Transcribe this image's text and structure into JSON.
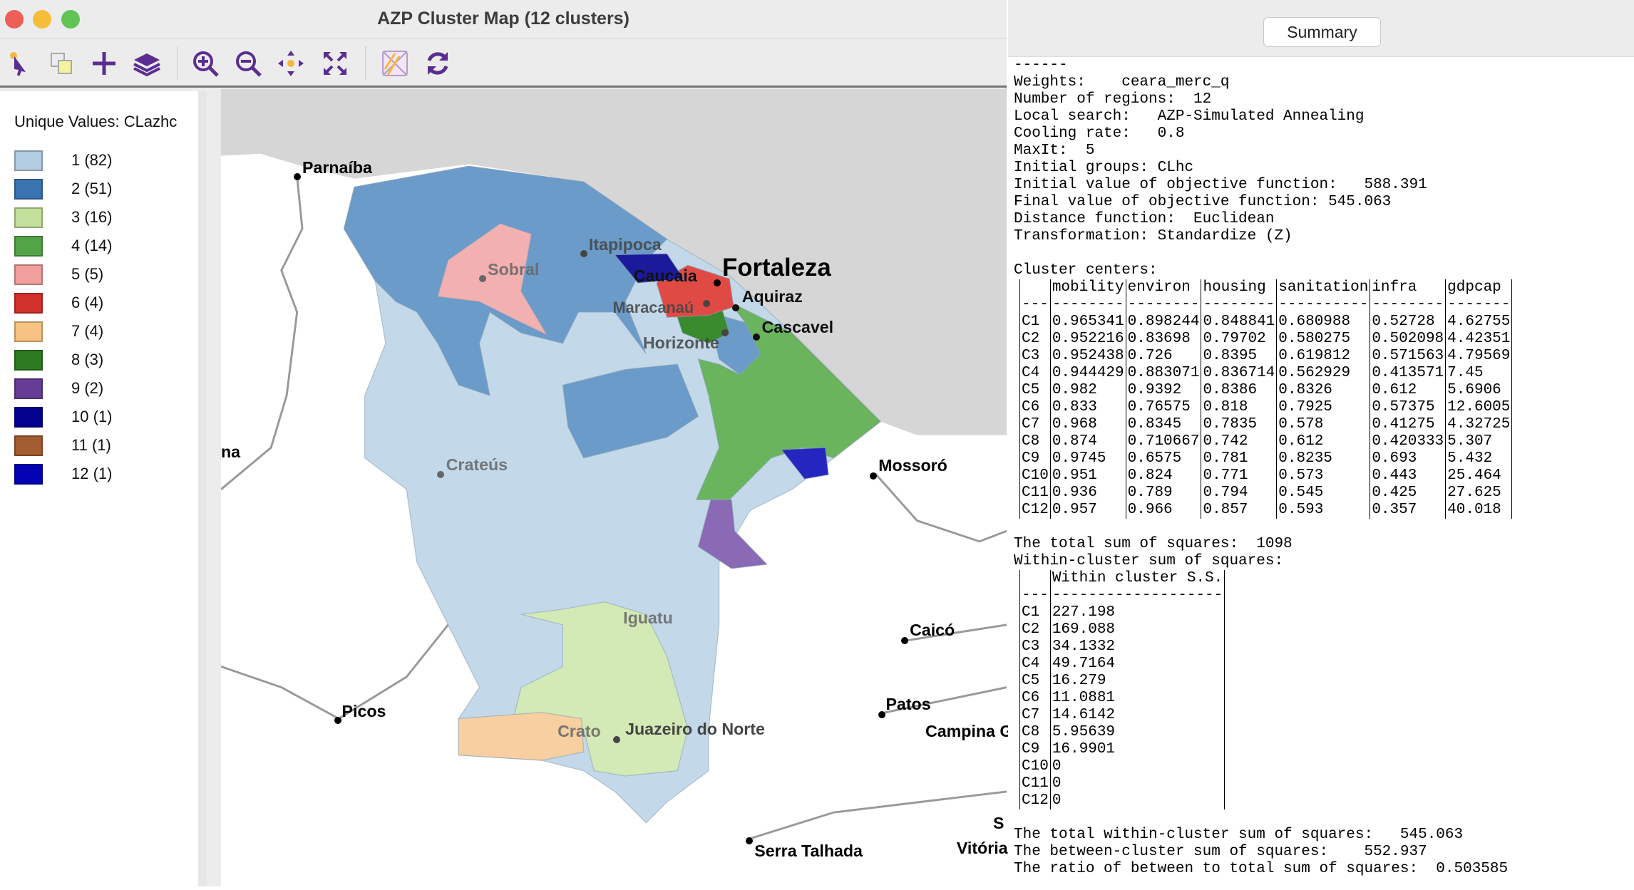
{
  "window": {
    "title": "AZP Cluster Map (12 clusters)",
    "traffic_lights": [
      "#ee5f57",
      "#f6bd3b",
      "#5fc454"
    ]
  },
  "toolbar": {
    "icons": [
      "select-pointer-icon",
      "copy-selection-icon",
      "add-icon",
      "layers-icon",
      "zoom-in-icon",
      "zoom-out-icon",
      "pan-icon",
      "fit-extent-icon",
      "basemap-icon",
      "refresh-icon"
    ],
    "accent": "#5b2d91"
  },
  "legend": {
    "title": "Unique Values: CLazhc",
    "items": [
      {
        "label": "1 (82)",
        "color": "#b3cde3"
      },
      {
        "label": "2 (51)",
        "color": "#3a74b0"
      },
      {
        "label": "3 (16)",
        "color": "#c2e09b"
      },
      {
        "label": "4 (14)",
        "color": "#52a447"
      },
      {
        "label": "5 (5)",
        "color": "#f09e9e"
      },
      {
        "label": "6 (4)",
        "color": "#d2312b"
      },
      {
        "label": "7 (4)",
        "color": "#f6c382"
      },
      {
        "label": "8 (3)",
        "color": "#2e7a22"
      },
      {
        "label": "9 (2)",
        "color": "#653d96"
      },
      {
        "label": "10 (1)",
        "color": "#02028f"
      },
      {
        "label": "11 (1)",
        "color": "#a35b30"
      },
      {
        "label": "12 (1)",
        "color": "#0303b3"
      }
    ]
  },
  "map": {
    "labels": {
      "parnaiba": "Parnaíba",
      "sobral": "Sobral",
      "itapipoca": "Itapipoca",
      "caucaia": "Caucaia",
      "fortaleza": "Fortaleza",
      "maracanau": "Maracanaú",
      "aquiraz": "Aquiraz",
      "horizonte": "Horizonte",
      "cascavel": "Cascavel",
      "crateus": "Crateús",
      "mossoro": "Mossoró",
      "iguatu": "Iguatu",
      "caico": "Caicó",
      "patos": "Patos",
      "campina": "Campina G",
      "picos": "Picos",
      "crato": "Crato",
      "juazeiro": "Juazeiro do Norte",
      "serra": "Serra Talhada",
      "vitoria": "Vitória",
      "na": "na",
      "s": "S"
    }
  },
  "summary": {
    "button": "Summary",
    "lines": [
      "------",
      "Weights:    ceara_merc_q",
      "Number of regions:  12",
      "Local search:   AZP-Simulated Annealing",
      "Cooling rate:   0.8",
      "MaxIt:  5",
      "Initial groups: CLhc",
      "Initial value of objective function:   588.391",
      "Final value of objective function: 545.063",
      "Distance function:  Euclidean",
      "Transformation: Standardize (Z)",
      "",
      "Cluster centers:"
    ],
    "centers": {
      "headers": [
        "",
        "mobility",
        "environ",
        "housing",
        "sanitation",
        "infra",
        "gdpcap"
      ],
      "rows": [
        [
          "C1",
          "0.965341",
          "0.898244",
          "0.848841",
          "0.680988",
          "0.52728",
          "4.62755"
        ],
        [
          "C2",
          "0.952216",
          "0.83698",
          "0.79702",
          "0.580275",
          "0.502098",
          "4.42351"
        ],
        [
          "C3",
          "0.952438",
          "0.726",
          "0.8395",
          "0.619812",
          "0.571563",
          "4.79569"
        ],
        [
          "C4",
          "0.944429",
          "0.883071",
          "0.836714",
          "0.562929",
          "0.413571",
          "7.45"
        ],
        [
          "C5",
          "0.982",
          "0.9392",
          "0.8386",
          "0.8326",
          "0.612",
          "5.6906"
        ],
        [
          "C6",
          "0.833",
          "0.76575",
          "0.818",
          "0.7925",
          "0.57375",
          "12.6005"
        ],
        [
          "C7",
          "0.968",
          "0.8345",
          "0.7835",
          "0.578",
          "0.41275",
          "4.32725"
        ],
        [
          "C8",
          "0.874",
          "0.710667",
          "0.742",
          "0.612",
          "0.420333",
          "5.307"
        ],
        [
          "C9",
          "0.9745",
          "0.6575",
          "0.781",
          "0.8235",
          "0.693",
          "5.432"
        ],
        [
          "C10",
          "0.951",
          "0.824",
          "0.771",
          "0.573",
          "0.443",
          "25.464"
        ],
        [
          "C11",
          "0.936",
          "0.789",
          "0.794",
          "0.545",
          "0.425",
          "27.625"
        ],
        [
          "C12",
          "0.957",
          "0.966",
          "0.857",
          "0.593",
          "0.357",
          "40.018"
        ]
      ]
    },
    "total_ss": "The total sum of squares:  1098",
    "within_title": "Within-cluster sum of squares:",
    "within": {
      "header": "Within cluster S.S.",
      "rows": [
        [
          "C1",
          "227.198"
        ],
        [
          "C2",
          "169.088"
        ],
        [
          "C3",
          "34.1332"
        ],
        [
          "C4",
          "49.7164"
        ],
        [
          "C5",
          "16.279"
        ],
        [
          "C6",
          "11.0881"
        ],
        [
          "C7",
          "14.6142"
        ],
        [
          "C8",
          "5.95639"
        ],
        [
          "C9",
          "16.9901"
        ],
        [
          "C10",
          "0"
        ],
        [
          "C11",
          "0"
        ],
        [
          "C12",
          "0"
        ]
      ]
    },
    "footer": [
      "The total within-cluster sum of squares:   545.063",
      "The between-cluster sum of squares:    552.937",
      "The ratio of between to total sum of squares:  0.503585"
    ]
  }
}
